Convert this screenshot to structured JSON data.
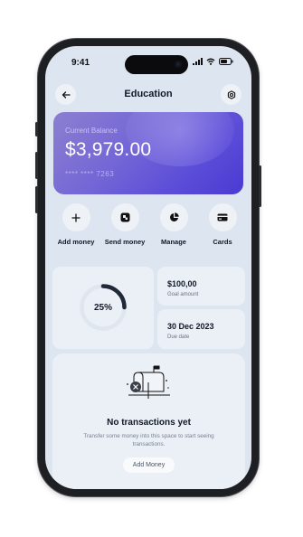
{
  "status": {
    "time": "9:41"
  },
  "header": {
    "title": "Education"
  },
  "balance": {
    "label": "Current Balance",
    "amount": "$3,979.00",
    "card_number": "**** **** 7263"
  },
  "actions": [
    {
      "label": "Add money",
      "icon": "plus-icon"
    },
    {
      "label": "Send money",
      "icon": "send-icon"
    },
    {
      "label": "Manage",
      "icon": "pie-chart-icon"
    },
    {
      "label": "Cards",
      "icon": "card-icon"
    }
  ],
  "progress": {
    "percent_label": "25%",
    "percent": 25
  },
  "goal": {
    "value": "$100,00",
    "label": "Goal amount"
  },
  "due": {
    "value": "30 Dec 2023",
    "label": "Due date"
  },
  "empty_state": {
    "title": "No transactions yet",
    "description": "Transfer some money into this space to start seeing transactions.",
    "button": "Add Money",
    "icon": "mailbox-icon"
  },
  "colors": {
    "card_gradient_start": "#8b7fd0",
    "card_gradient_end": "#4a3bd2",
    "screen_bg": "#dde6f0",
    "progress_ring": "#1f2937"
  }
}
